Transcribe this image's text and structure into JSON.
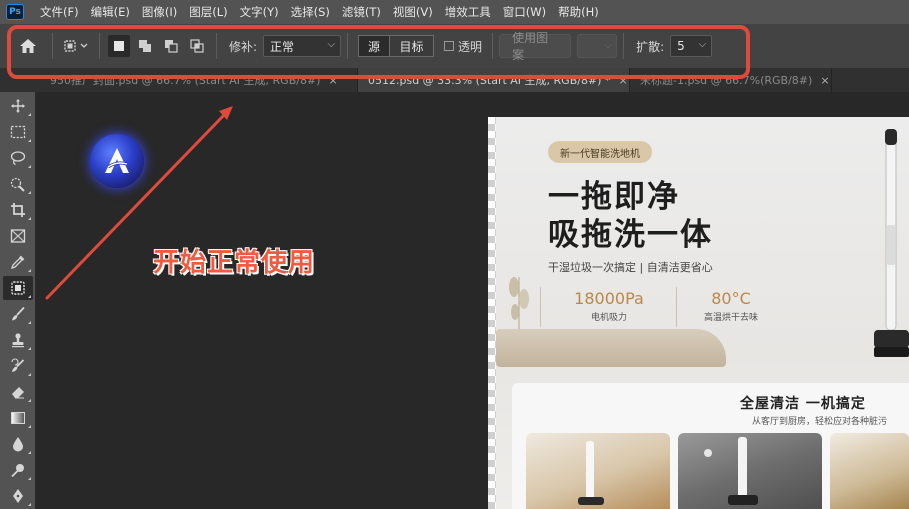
{
  "menubar": {
    "app_icon": "Ps",
    "items": [
      "文件(F)",
      "编辑(E)",
      "图像(I)",
      "图层(L)",
      "文字(Y)",
      "选择(S)",
      "滤镜(T)",
      "视图(V)",
      "增效工具",
      "窗口(W)",
      "帮助(H)"
    ]
  },
  "options": {
    "repair_label": "修补:",
    "repair_value": "正常",
    "source_label": "源",
    "target_label": "目标",
    "transparent_label": "透明",
    "use_pattern_label": "使用图案",
    "diffusion_label": "扩散:",
    "diffusion_value": "5",
    "highlight_color": "#dd4b3c"
  },
  "tabs": [
    {
      "label": "950推广封面.psd @ 66.7% (Start AI 生成, RGB/8#)",
      "close": "×",
      "active": false
    },
    {
      "label": "0512.psd @ 33.3% (Start AI 生成, RGB/8#) *",
      "close": "×",
      "active": true
    },
    {
      "label": "未标题-1.psd @ 66.7%(RGB/8#)",
      "close": "×",
      "active": false
    }
  ],
  "tools": [
    "move-tool-icon",
    "marquee-tool-icon",
    "lasso-tool-icon",
    "quick-select-tool-icon",
    "crop-tool-icon",
    "frame-tool-icon",
    "eyedropper-tool-icon",
    "patch-tool-icon",
    "brush-tool-icon",
    "stamp-tool-icon",
    "history-brush-tool-icon",
    "eraser-tool-icon",
    "gradient-tool-icon",
    "blur-tool-icon",
    "dodge-tool-icon",
    "pen-tool-icon"
  ],
  "callout": {
    "text": "开始正常使用",
    "color": "#f15a3f"
  },
  "poster": {
    "badge": "新一代智能洗地机",
    "headline1": "一拖即净",
    "headline2": "吸拖洗一体",
    "subline": "干湿垃圾一次搞定   |   自清洁更省心",
    "stat1_value": "18000Pa",
    "stat1_label": "电机吸力",
    "stat2_value": "80°C",
    "stat2_label": "高温烘干去味",
    "lower_title": "全屋清洁 一机搞定",
    "lower_sub": "从客厅到厨房，轻松应对各种脏污",
    "accent": "#b8894a"
  }
}
